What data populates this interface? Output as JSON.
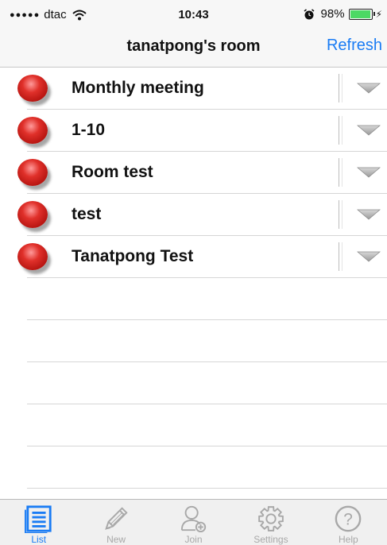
{
  "status_bar": {
    "carrier": "dtac",
    "time": "10:43",
    "battery_percent": "98%",
    "battery_level": 0.98
  },
  "nav": {
    "title": "tanatpong's room",
    "refresh_label": "Refresh"
  },
  "rooms": [
    {
      "name": "Monthly meeting",
      "status_color": "#e0302a"
    },
    {
      "name": "1-10",
      "status_color": "#e0302a"
    },
    {
      "name": "Room test",
      "status_color": "#e0302a"
    },
    {
      "name": "test",
      "status_color": "#e0302a"
    },
    {
      "name": "Tanatpong Test",
      "status_color": "#e0302a"
    }
  ],
  "tabs": [
    {
      "label": "List",
      "icon": "list-icon",
      "active": true
    },
    {
      "label": "New",
      "icon": "pencil-icon",
      "active": false
    },
    {
      "label": "Join",
      "icon": "join-user-icon",
      "active": false
    },
    {
      "label": "Settings",
      "icon": "gear-icon",
      "active": false
    },
    {
      "label": "Help",
      "icon": "help-icon",
      "active": false
    }
  ],
  "colors": {
    "accent": "#1a7cf4",
    "inactive_tab": "#a8a8a8",
    "status_red": "#e0302a"
  }
}
